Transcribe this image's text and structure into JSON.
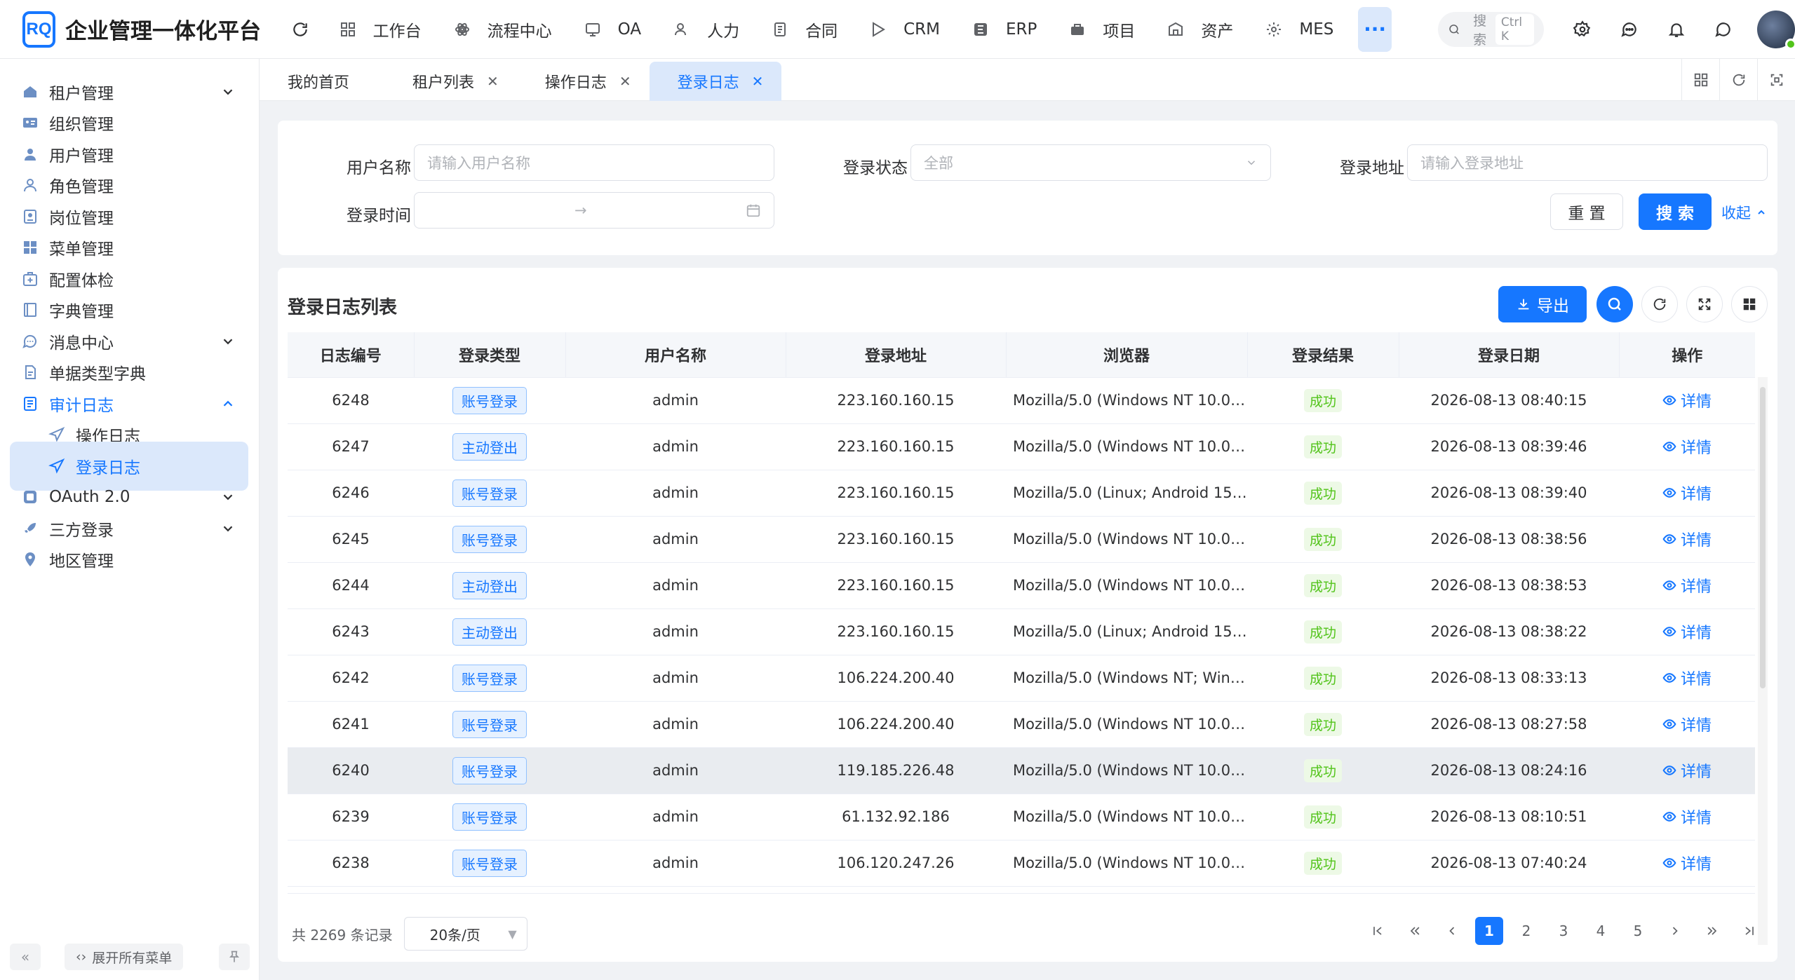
{
  "app": {
    "logo_mark": "RQ",
    "title": "企业管理一体化平台"
  },
  "topnav": [
    {
      "label": "工作台",
      "icon": "grid-icon"
    },
    {
      "label": "流程中心",
      "icon": "flow-icon"
    },
    {
      "label": "OA",
      "icon": "oa-icon"
    },
    {
      "label": "人力",
      "icon": "person-icon"
    },
    {
      "label": "合同",
      "icon": "contract-icon"
    },
    {
      "label": "CRM",
      "icon": "crm-icon"
    },
    {
      "label": "ERP",
      "icon": "erp-icon"
    },
    {
      "label": "项目",
      "icon": "project-icon"
    },
    {
      "label": "资产",
      "icon": "asset-icon"
    },
    {
      "label": "MES",
      "icon": "mes-icon"
    }
  ],
  "topnav_more": "···",
  "search": {
    "placeholder": "搜索",
    "shortcut": "Ctrl K"
  },
  "sidebar": {
    "items": [
      {
        "label": "租户管理"
      },
      {
        "label": "组织管理"
      },
      {
        "label": "用户管理"
      },
      {
        "label": "角色管理"
      },
      {
        "label": "岗位管理"
      },
      {
        "label": "菜单管理"
      },
      {
        "label": "配置体检"
      },
      {
        "label": "字典管理"
      },
      {
        "label": "消息中心"
      },
      {
        "label": "单据类型字典"
      },
      {
        "label": "审计日志"
      },
      {
        "label": "操作日志"
      },
      {
        "label": "登录日志"
      },
      {
        "label": "OAuth 2.0"
      },
      {
        "label": "三方登录"
      },
      {
        "label": "地区管理"
      }
    ],
    "expand_all": "展开所有菜单",
    "collapse_glyph": "«"
  },
  "tabs": [
    {
      "label": "我的首页"
    },
    {
      "label": "租户列表"
    },
    {
      "label": "操作日志"
    },
    {
      "label": "登录日志"
    }
  ],
  "tab_close_glyph": "✕",
  "filter": {
    "username_label": "用户名称",
    "username_placeholder": "请输入用户名称",
    "status_label": "登录状态",
    "status_value": "全部",
    "address_label": "登录地址",
    "address_placeholder": "请输入登录地址",
    "time_label": "登录时间",
    "range_arrow": "→",
    "reset": "重 置",
    "search": "搜 索",
    "collapse": "收起"
  },
  "table": {
    "title": "登录日志列表",
    "export": "导出",
    "columns": [
      "日志编号",
      "登录类型",
      "用户名称",
      "登录地址",
      "浏览器",
      "登录结果",
      "登录日期",
      "操作"
    ],
    "action_label": "详情",
    "rows": [
      {
        "id": "6248",
        "type": "账号登录",
        "user": "admin",
        "ip": "223.160.160.15",
        "browser": "Mozilla/5.0 (Windows NT 10.0; ...",
        "result": "成功",
        "date": "2026-08-13 08:40:15"
      },
      {
        "id": "6247",
        "type": "主动登出",
        "user": "admin",
        "ip": "223.160.160.15",
        "browser": "Mozilla/5.0 (Windows NT 10.0; ...",
        "result": "成功",
        "date": "2026-08-13 08:39:46"
      },
      {
        "id": "6246",
        "type": "账号登录",
        "user": "admin",
        "ip": "223.160.160.15",
        "browser": "Mozilla/5.0 (Linux; Android 15; P...",
        "result": "成功",
        "date": "2026-08-13 08:39:40"
      },
      {
        "id": "6245",
        "type": "账号登录",
        "user": "admin",
        "ip": "223.160.160.15",
        "browser": "Mozilla/5.0 (Windows NT 10.0; ...",
        "result": "成功",
        "date": "2026-08-13 08:38:56"
      },
      {
        "id": "6244",
        "type": "主动登出",
        "user": "admin",
        "ip": "223.160.160.15",
        "browser": "Mozilla/5.0 (Windows NT 10.0; ...",
        "result": "成功",
        "date": "2026-08-13 08:38:53"
      },
      {
        "id": "6243",
        "type": "主动登出",
        "user": "admin",
        "ip": "223.160.160.15",
        "browser": "Mozilla/5.0 (Linux; Android 15; P...",
        "result": "成功",
        "date": "2026-08-13 08:38:22"
      },
      {
        "id": "6242",
        "type": "账号登录",
        "user": "admin",
        "ip": "106.224.200.40",
        "browser": "Mozilla/5.0 (Windows NT; Wind...",
        "result": "成功",
        "date": "2026-08-13 08:33:13"
      },
      {
        "id": "6241",
        "type": "账号登录",
        "user": "admin",
        "ip": "106.224.200.40",
        "browser": "Mozilla/5.0 (Windows NT 10.0; ...",
        "result": "成功",
        "date": "2026-08-13 08:27:58"
      },
      {
        "id": "6240",
        "type": "账号登录",
        "user": "admin",
        "ip": "119.185.226.48",
        "browser": "Mozilla/5.0 (Windows NT 10.0; ...",
        "result": "成功",
        "date": "2026-08-13 08:24:16"
      },
      {
        "id": "6239",
        "type": "账号登录",
        "user": "admin",
        "ip": "61.132.92.186",
        "browser": "Mozilla/5.0 (Windows NT 10.0; ...",
        "result": "成功",
        "date": "2026-08-13 08:10:51"
      },
      {
        "id": "6238",
        "type": "账号登录",
        "user": "admin",
        "ip": "106.120.247.26",
        "browser": "Mozilla/5.0 (Windows NT 10.0; ...",
        "result": "成功",
        "date": "2026-08-13 07:40:24"
      }
    ]
  },
  "pagination": {
    "total_text": "共 2269 条记录",
    "page_size": "20条/页",
    "pages": [
      "1",
      "2",
      "3",
      "4",
      "5"
    ],
    "current": "1"
  },
  "colors": {
    "primary": "#1677ff",
    "active_bg": "#dbe8fb",
    "success": "#52c41a"
  }
}
